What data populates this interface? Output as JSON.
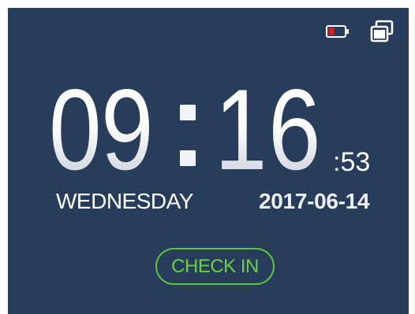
{
  "status_bar": {
    "icons": [
      "battery-low-icon",
      "screen-mirror-icon"
    ],
    "battery_level_color": "#e02020",
    "battery_outline_color": "#ffffff"
  },
  "clock": {
    "hour_tens": "0",
    "hour_ones": "9",
    "separator": ":",
    "minute_tens": "1",
    "minute_ones": "6",
    "seconds": ":53"
  },
  "weekday": "WEDNESDAY",
  "date": "2017-06-14",
  "checkin": {
    "label": "CHECK IN",
    "accent_color": "#5ec43c"
  },
  "colors": {
    "background": "#283d5b",
    "text": "#ffffff"
  }
}
